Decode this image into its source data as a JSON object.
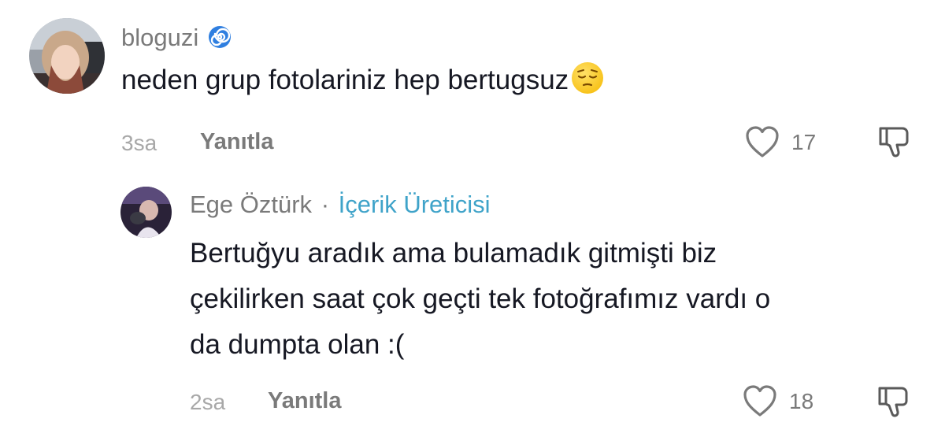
{
  "comment": {
    "username": "bloguzi",
    "text": "neden grup fotolariniz hep bertugsuz",
    "time": "3sa",
    "reply_label": "Yanıtla",
    "likes": "17"
  },
  "reply": {
    "username": "Ege Öztürk",
    "separator": "·",
    "badge": "İçerik Üreticisi",
    "lines": [
      "Bertuğyu aradık ama bulamadık gitmişti biz",
      "çekilirken saat çok geçti tek fotoğrafımız vardı o",
      "da dumpta olan :("
    ],
    "time": "2sa",
    "reply_label": "Yanıtla",
    "likes": "18"
  },
  "colors": {
    "badge": "#3fa3c9",
    "text": "#161823",
    "muted": "#7a7a7a"
  },
  "icons": [
    "spiral-emoji-icon",
    "pensive-face-emoji-icon",
    "heart-outline-icon",
    "thumbs-down-icon"
  ]
}
